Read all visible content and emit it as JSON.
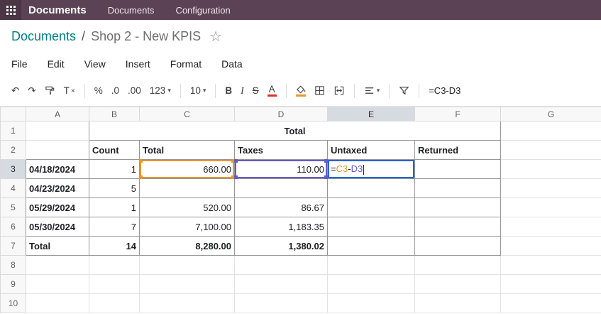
{
  "topbar": {
    "app": "Documents",
    "nav": [
      "Documents",
      "Configuration"
    ]
  },
  "breadcrumb": {
    "parent": "Documents",
    "sep": "/",
    "current": "Shop 2 - New KPIS",
    "star": "☆"
  },
  "menus": {
    "items": [
      "File",
      "Edit",
      "View",
      "Insert",
      "Format",
      "Data"
    ]
  },
  "toolbar": {
    "undo": "↶",
    "redo": "↷",
    "clear_format": "T",
    "clear_format_x": "×",
    "percent": "%",
    "decimal_decrease": ".0",
    "decimal_increase": ".00",
    "more_formats": "123",
    "font_size": "10",
    "bold": "B",
    "italic": "I",
    "strikethrough": "S",
    "text_color": "A",
    "caret": "▾",
    "formula": "=C3-D3"
  },
  "sheet": {
    "col_headers": [
      "A",
      "B",
      "C",
      "D",
      "E",
      "F",
      "G"
    ],
    "row_headers": [
      "1",
      "2",
      "3",
      "4",
      "5",
      "6",
      "7",
      "8",
      "9",
      "10"
    ],
    "title": "Total",
    "headers": {
      "count": "Count",
      "total": "Total",
      "taxes": "Taxes",
      "untaxed": "Untaxed",
      "returned": "Returned"
    },
    "rows": [
      {
        "date": "04/18/2024",
        "count": "1",
        "total": "660.00",
        "taxes": "110.00"
      },
      {
        "date": "04/23/2024",
        "count": "5",
        "total": "",
        "taxes": ""
      },
      {
        "date": "05/29/2024",
        "count": "1",
        "total": "520.00",
        "taxes": "86.67"
      },
      {
        "date": "05/30/2024",
        "count": "7",
        "total": "7,100.00",
        "taxes": "1,183.35"
      }
    ],
    "total_row": {
      "label": "Total",
      "count": "14",
      "total": "8,280.00",
      "taxes": "1,380.02"
    },
    "active_cell": {
      "ref": "E3",
      "eq": "=",
      "ref1": "C3",
      "op": "-",
      "ref2": "D3"
    }
  },
  "colors": {
    "topbar_bg": "#5b4254",
    "link_teal": "#017e84",
    "ref1_highlight": "#e8962e",
    "ref2_highlight": "#655cc5",
    "selection_blue": "#2a63d4",
    "date_count_bg": "#cfe2f3",
    "total_col_bg": "#fff2cc",
    "taxes_col_bg": "#d9d2e9",
    "untaxed_col_bg": "#fce5cd",
    "returned_col_bg": "#d9ead3",
    "header_row_bg": "#e9e9e9",
    "total_row_bg": "#efefef"
  }
}
